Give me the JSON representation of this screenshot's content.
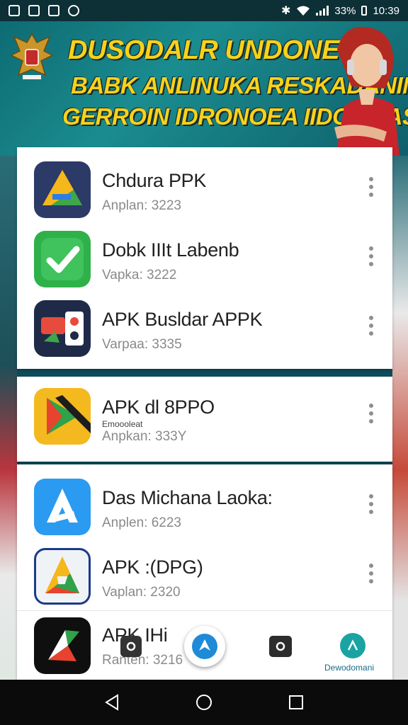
{
  "status_bar": {
    "battery": "33%",
    "time": "10:39",
    "icons": [
      "gallery-icon",
      "photo-icon",
      "image-icon",
      "vpn-icon",
      "bluetooth-icon",
      "wifi-icon",
      "signal-icon",
      "battery-icon"
    ]
  },
  "banner": {
    "line1": "DUSODALR UNDONESIA",
    "line2": "BABK ANLINUKA RESKADANIN",
    "line3": "GERROIN IDRONOEA IIDOMDAS",
    "text_color": "#f6d21b"
  },
  "apps": [
    {
      "name": "Chdura PPK",
      "version": "Anplan: 3223",
      "icon": "triangle-arrow-icon",
      "icon_bg": "#2b3a66"
    },
    {
      "name": "Dobk IIIt Labenb",
      "version": "Vapka: 3222",
      "icon": "check-icon",
      "icon_bg": "#2fb14a"
    },
    {
      "name": "APK Busldar APPK",
      "version": "Varpaa: 3335",
      "icon": "gamepad-icon",
      "icon_bg": "#1f2a48"
    },
    {
      "name": "APK dl 8PPO",
      "sub_name": "Emoooleat",
      "version": "Anpkan: 333Y",
      "icon": "play-ribbon-icon",
      "icon_bg": "#f4b91e"
    },
    {
      "name": "Das Michana Laoka:",
      "version": "Anplen: 6223",
      "icon": "letter-a-icon",
      "icon_bg": "#2a9bf0"
    },
    {
      "name": "APK :(DPG)",
      "version": "Vaplan: 2320",
      "icon": "letter-a-apk-icon",
      "icon_bg": "#f0f3f6"
    },
    {
      "name": "APK IHi",
      "version": "Ranten: 3216",
      "icon": "compass-icon",
      "icon_bg": "#0f0f0f"
    }
  ],
  "bottom_tools": {
    "label": "Dewodomani"
  },
  "nav": {
    "buttons": [
      "back-button",
      "home-button",
      "recents-button"
    ]
  }
}
